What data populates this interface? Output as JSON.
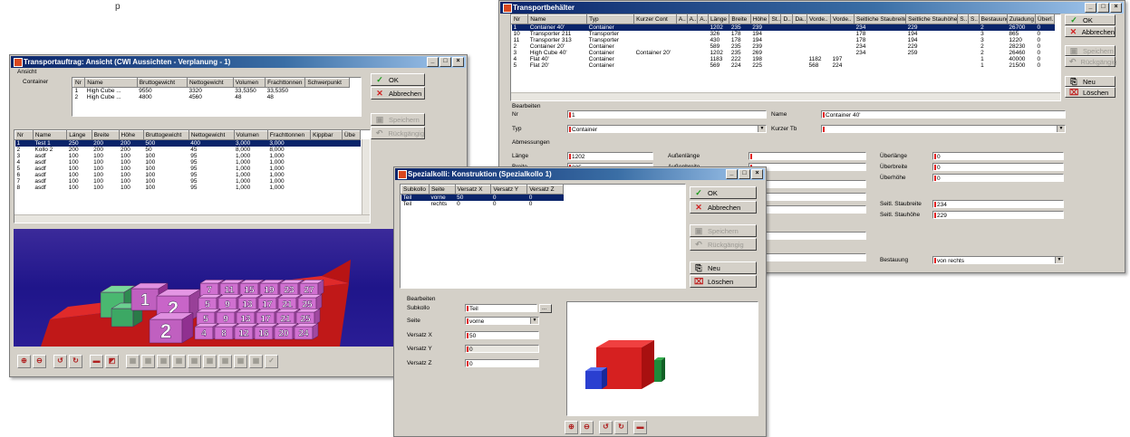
{
  "colors": {
    "title_active": "#0a246a",
    "selection": "#0a246a",
    "red_marker": "#e02020",
    "window_bg": "#d4d0c8",
    "scene_bg": "#2a1d95"
  },
  "top_text": "p",
  "buttons": {
    "ok": "OK",
    "cancel": "Abbrechen",
    "save": "Speichern",
    "undo": "Rückgängig",
    "new": "Neu",
    "delete": "Löschen"
  },
  "transportbehaelter": {
    "title": "Transportbehälter",
    "columns": [
      "Nr",
      "Name",
      "Typ",
      "Kurzer Cont",
      "A..",
      "A..",
      "A..",
      "Länge",
      "Breite",
      "Höhe",
      "St..",
      "D..",
      "Da..",
      "Vorde..",
      "Vorde..",
      "Seitliche Staubreite",
      "Seitliche Stauhöhe",
      "S..",
      "S..",
      "Bestauung",
      "Zuladung",
      "Überl."
    ],
    "rows": [
      [
        "1",
        "Container 40'",
        "Container",
        "",
        "",
        "",
        "",
        "1202",
        "235",
        "239",
        "",
        "",
        "",
        "",
        "",
        "234",
        "229",
        "",
        "",
        "2",
        "26700",
        "0"
      ],
      [
        "10",
        "Transporter 211",
        "Transporter",
        "",
        "",
        "",
        "",
        "326",
        "178",
        "194",
        "",
        "",
        "",
        "",
        "",
        "178",
        "194",
        "",
        "",
        "3",
        "865",
        "0"
      ],
      [
        "11",
        "Transporter 313",
        "Transporter",
        "",
        "",
        "",
        "",
        "430",
        "178",
        "194",
        "",
        "",
        "",
        "",
        "",
        "178",
        "194",
        "",
        "",
        "3",
        "1220",
        "0"
      ],
      [
        "2",
        "Container 20'",
        "Container",
        "",
        "",
        "",
        "",
        "589",
        "235",
        "239",
        "",
        "",
        "",
        "",
        "",
        "234",
        "229",
        "",
        "",
        "2",
        "28230",
        "0"
      ],
      [
        "3",
        "High Cube 40'",
        "Container",
        "Container 20'",
        "",
        "",
        "",
        "1202",
        "235",
        "269",
        "",
        "",
        "",
        "",
        "",
        "234",
        "259",
        "",
        "",
        "2",
        "26460",
        "0"
      ],
      [
        "4",
        "Flat 40'",
        "Container",
        "",
        "",
        "",
        "",
        "1183",
        "222",
        "198",
        "",
        "",
        "",
        "1182",
        "197",
        "",
        "",
        "",
        "",
        "1",
        "40000",
        "0"
      ],
      [
        "5",
        "Flat 20'",
        "Container",
        "",
        "",
        "",
        "",
        "569",
        "224",
        "225",
        "",
        "",
        "",
        "568",
        "224",
        "",
        "",
        "",
        "",
        "1",
        "21500",
        "0"
      ]
    ],
    "bearbeiten": "Bearbeiten",
    "nr_label": "Nr",
    "nr_value": "1",
    "typ_label": "Typ",
    "typ_value": "Container",
    "name_label": "Name",
    "name_value": "Container 40'",
    "kurzer_label": "Kurzer Tb",
    "kurzer_value": "",
    "abmessungen": "Abmessungen",
    "laenge_label": "Länge",
    "laenge_value": "1202",
    "breite_label": "Breite",
    "breite_value": "235",
    "aussenlaenge_label": "Außenlänge",
    "aussenbreite_label": "Außenbreite",
    "ueberlaenge_label": "Überlänge",
    "ueberlaenge_value": "0",
    "ueberbreite_label": "Überbreite",
    "ueberbreite_value": "0",
    "ueberhoehe_label": "Überhöhe",
    "ueberhoehe_value": "0",
    "staubreite_label": "Seitl. Staubreite",
    "staubreite_value": "234",
    "stauhoehe_label": "Seitl. Stauhöhe",
    "stauhoehe_value": "229",
    "bestauung_label": "Bestauung",
    "bestauung_value": "von rechts"
  },
  "transportauftrag": {
    "title": "Transportauftrag: Ansicht (CWI Aussichten - Verplanung - 1)",
    "ansicht_label": "Ansicht",
    "container_label": "Container",
    "container_columns": [
      "Nr",
      "Name",
      "Bruttogewicht",
      "Nettogewicht",
      "Volumen",
      "Frachttonnen",
      "Schwerpunkt"
    ],
    "container_rows": [
      [
        "1",
        "High Cube ...",
        "9550",
        "3320",
        "33,5350",
        "33,5350",
        ""
      ],
      [
        "2",
        "High Cube ...",
        "4800",
        "4560",
        "48",
        "48",
        ""
      ]
    ],
    "columns": [
      "Nr",
      "Name",
      "Länge",
      "Breite",
      "Höhe",
      "Bruttogewicht",
      "Nettogewicht",
      "Volumen",
      "Frachttonnen",
      "Kippbar",
      "Übe"
    ],
    "rows": [
      [
        "1",
        "Test 1",
        "250",
        "200",
        "200",
        "500",
        "400",
        "3,000",
        "3,000",
        "",
        ""
      ],
      [
        "2",
        "Kollo 2",
        "200",
        "200",
        "200",
        "50",
        "45",
        "8,000",
        "8,000",
        "",
        ""
      ],
      [
        "3",
        "asdf",
        "100",
        "100",
        "100",
        "100",
        "95",
        "1,000",
        "1,000",
        "",
        ""
      ],
      [
        "4",
        "asdf",
        "100",
        "100",
        "100",
        "100",
        "95",
        "1,000",
        "1,000",
        "",
        ""
      ],
      [
        "5",
        "asdf",
        "100",
        "100",
        "100",
        "100",
        "95",
        "1,000",
        "1,000",
        "",
        ""
      ],
      [
        "6",
        "asdf",
        "100",
        "100",
        "100",
        "100",
        "95",
        "1,000",
        "1,000",
        "",
        ""
      ],
      [
        "7",
        "asdf",
        "100",
        "100",
        "100",
        "100",
        "95",
        "1,000",
        "1,000",
        "",
        ""
      ],
      [
        "8",
        "asdf",
        "100",
        "100",
        "100",
        "100",
        "95",
        "1,000",
        "1,000",
        "",
        ""
      ]
    ],
    "side_nr": "Nr",
    "box_numbers_front": [
      "1",
      "2",
      "2"
    ],
    "box_numbers_top": [
      "7",
      "11",
      "15",
      "19",
      "23",
      "27",
      "5",
      "9",
      "13",
      "17",
      "21",
      "25",
      "5",
      "9",
      "13",
      "17",
      "21",
      "25",
      "4",
      "8",
      "12",
      "16",
      "20",
      "24"
    ]
  },
  "spezialkolli": {
    "title": "Spezialkolli: Konstruktion (Spezialkollo 1)",
    "columns": [
      "Subkollo",
      "Seite",
      "Versatz X",
      "Versatz Y",
      "Versatz Z"
    ],
    "rows": [
      [
        "Teil",
        "vorne",
        "50",
        "0",
        "0"
      ],
      [
        "Teil",
        "rechts",
        "0",
        "0",
        "0"
      ]
    ],
    "bearbeiten": "Bearbeiten",
    "subkollo_label": "Subkollo",
    "subkollo_value": "Teil",
    "seite_label": "Seite",
    "seite_value": "vorne",
    "versatzx_label": "Versatz X",
    "versatzx_value": "50",
    "versatzy_label": "Versatz Y",
    "versatzy_value": "0",
    "versatzz_label": "Versatz Z",
    "versatzz_value": "0",
    "dots": "..."
  },
  "icons": [
    "zoom-in-icon",
    "zoom-out-icon",
    "rotate-left-icon",
    "rotate-right-icon",
    "container-icon",
    "ok-check-icon",
    "cancel-x-icon",
    "save-disk-icon",
    "undo-arrow-icon",
    "new-document-icon",
    "delete-icon"
  ]
}
